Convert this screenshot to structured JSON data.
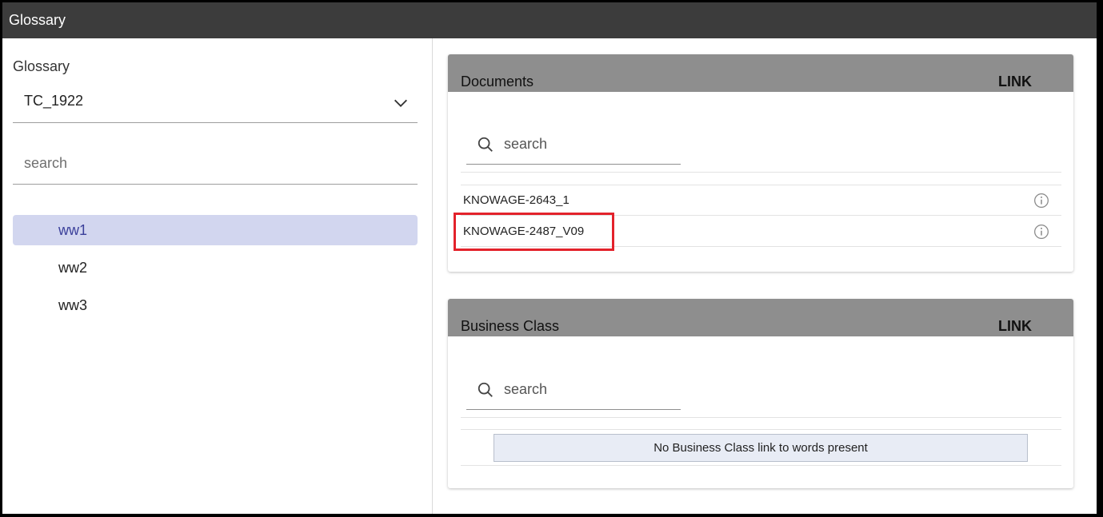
{
  "window": {
    "title": "Glossary"
  },
  "glossary_panel": {
    "label": "Glossary",
    "selected_glossary": "TC_1922",
    "search_placeholder": "search",
    "words": [
      {
        "label": "ww1",
        "selected": true
      },
      {
        "label": "ww2",
        "selected": false
      },
      {
        "label": "ww3",
        "selected": false
      }
    ]
  },
  "documents_card": {
    "title": "Documents",
    "link_label": "LINK",
    "search_placeholder": "search",
    "items": [
      {
        "name": "KNOWAGE-2643_1"
      },
      {
        "name": "KNOWAGE-2487_V09"
      }
    ]
  },
  "business_class_card": {
    "title": "Business Class",
    "link_label": "LINK",
    "search_placeholder": "search",
    "empty_message": "No Business Class link to words present"
  },
  "colors": {
    "topbar": "#3c3c3c",
    "card_header": "#8e8e8e",
    "selected_item_bg": "#d2d6ef",
    "highlight_border": "#e3222b"
  }
}
